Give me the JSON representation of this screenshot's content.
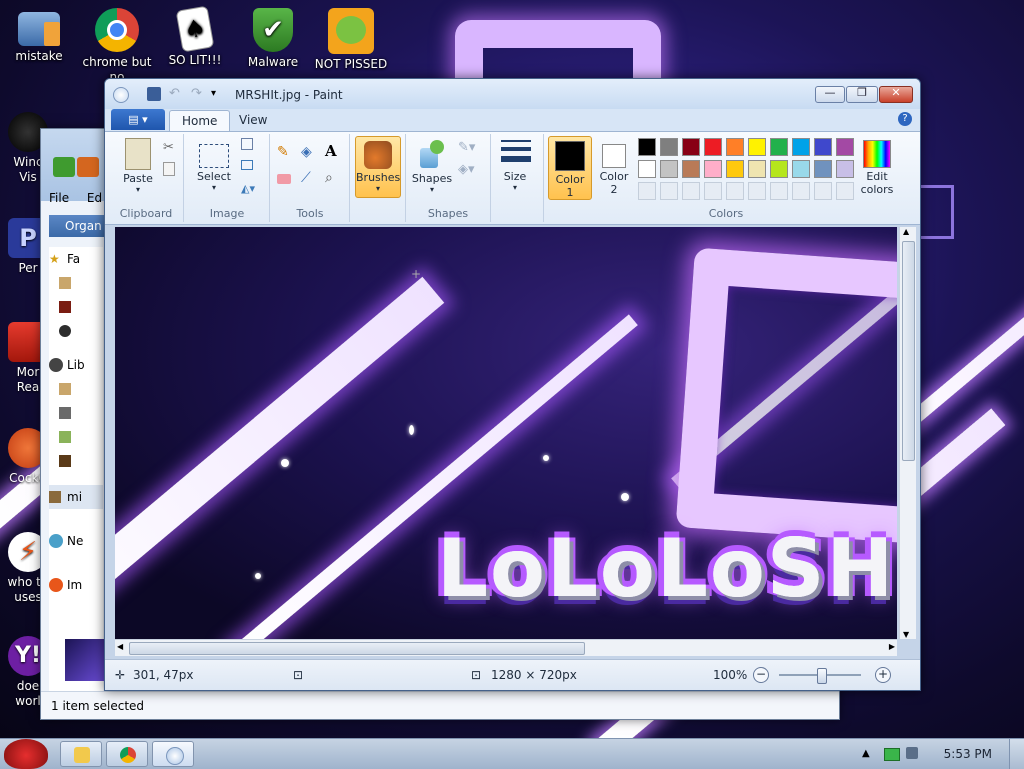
{
  "desktop": {
    "icons": [
      {
        "label": "mistake",
        "name": "desktop-icon-mistake"
      },
      {
        "label": "chrome but",
        "label2": "no",
        "name": "desktop-icon-chrome"
      },
      {
        "label": "SO LIT!!!",
        "name": "desktop-icon-solitaire"
      },
      {
        "label": "Malware",
        "name": "desktop-icon-malware"
      },
      {
        "label": "NOT PISSED",
        "name": "desktop-icon-not-pissed"
      }
    ],
    "left_icons": [
      {
        "label": "Winc",
        "label2": "Vis"
      },
      {
        "label": "Per"
      },
      {
        "label": "Mor",
        "label2": "Rea"
      },
      {
        "label": "CockC"
      },
      {
        "label": "who th",
        "label2": "uses"
      },
      {
        "label": "doe",
        "label2": "worl"
      }
    ]
  },
  "explorer": {
    "menu_file": "File",
    "menu_edit": "Ed",
    "organize": "Organ",
    "nav": [
      "Fa",
      "",
      "",
      "",
      "Lib",
      "",
      "",
      "",
      "",
      "mi",
      "Ne",
      "Im"
    ],
    "status": "1 item selected"
  },
  "paint": {
    "title": "MRSHIt.jpg - Paint",
    "tabs": {
      "home": "Home",
      "view": "View"
    },
    "groups": {
      "clipboard": {
        "label": "Clipboard",
        "paste": "Paste"
      },
      "image": {
        "label": "Image",
        "select": "Select"
      },
      "tools": {
        "label": "Tools"
      },
      "brushes": {
        "label": "Brushes"
      },
      "shapes": {
        "label": "Shapes",
        "shapes_btn": "Shapes"
      },
      "size": {
        "label": "Size"
      },
      "colors": {
        "label": "Colors",
        "color1": "Color",
        "color1_n": "1",
        "color2": "Color",
        "color2_n": "2",
        "edit": "Edit",
        "edit2": "colors"
      }
    },
    "palette_row1": [
      "#000000",
      "#7f7f7f",
      "#880015",
      "#ed1c24",
      "#ff7f27",
      "#fff200",
      "#22b14c",
      "#00a2e8",
      "#3f48cc",
      "#a349a4"
    ],
    "palette_row2": [
      "#ffffff",
      "#c3c3c3",
      "#b97a57",
      "#ffaec9",
      "#ffc90e",
      "#efe4b0",
      "#b5e61d",
      "#99d9ea",
      "#7092be",
      "#c8bfe7"
    ],
    "canvas_logo_text": "LoLoLoSH",
    "status": {
      "cursor_pos": "301, 47px",
      "image_size": "1280 × 720px",
      "zoom": "100%"
    }
  },
  "taskbar": {
    "clock": "5:53 PM"
  }
}
